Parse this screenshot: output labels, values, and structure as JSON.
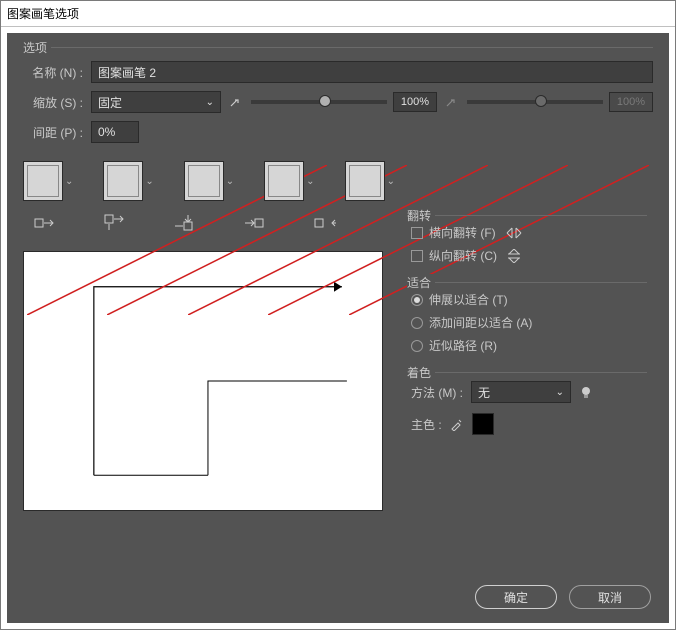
{
  "window": {
    "title": "图案画笔选项"
  },
  "options": {
    "title": "选项",
    "name_label": "名称 (N) :",
    "name_value": "图案画笔 2",
    "scale_label": "缩放 (S) :",
    "scale_mode": "固定",
    "scale_pct": "100%",
    "scale_pct2": "100%",
    "spacing_label": "间距 (P) :",
    "spacing_value": "0%"
  },
  "flip": {
    "title": "翻转",
    "h_label": "横向翻转 (F)",
    "v_label": "纵向翻转 (C)"
  },
  "fit": {
    "title": "适合",
    "stretch": "伸展以适合 (T)",
    "addspace": "添加间距以适合 (A)",
    "approx": "近似路径 (R)",
    "selected": "stretch"
  },
  "colorize": {
    "title": "着色",
    "method_label": "方法 (M) :",
    "method_value": "无",
    "key_label": "主色 :"
  },
  "buttons": {
    "ok": "确定",
    "cancel": "取消"
  }
}
